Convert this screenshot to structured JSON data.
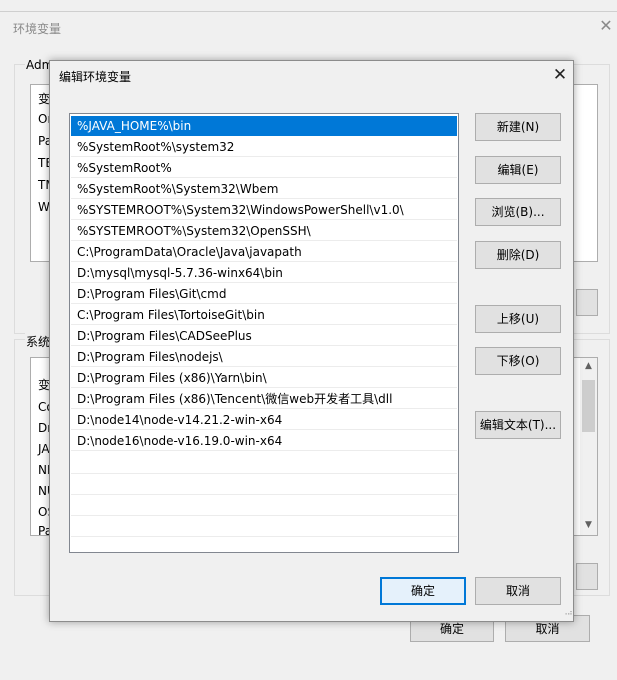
{
  "back_window": {
    "title": "环境变量",
    "user_group_label": "Adm",
    "user_rows": [
      "变",
      "On",
      "Pa",
      "TE",
      "TM",
      "W"
    ],
    "system_group_label": "系统",
    "system_rows": [
      "变",
      "Co",
      "Dr",
      "JA",
      "NL",
      "NU",
      "OS",
      "Pa"
    ],
    "ok_label": "确定",
    "cancel_label": "取消"
  },
  "dialog": {
    "title": "编辑环境变量",
    "paths": [
      "%JAVA_HOME%\\bin",
      "%SystemRoot%\\system32",
      "%SystemRoot%",
      "%SystemRoot%\\System32\\Wbem",
      "%SYSTEMROOT%\\System32\\WindowsPowerShell\\v1.0\\",
      "%SYSTEMROOT%\\System32\\OpenSSH\\",
      "C:\\ProgramData\\Oracle\\Java\\javapath",
      "D:\\mysql\\mysql-5.7.36-winx64\\bin",
      "D:\\Program Files\\Git\\cmd",
      "C:\\Program Files\\TortoiseGit\\bin",
      "D:\\Program Files\\CADSeePlus",
      "D:\\Program Files\\nodejs\\",
      "D:\\Program Files (x86)\\Yarn\\bin\\",
      "D:\\Program Files (x86)\\Tencent\\微信web开发者工具\\dll",
      "D:\\node14\\node-v14.21.2-win-x64",
      "D:\\node16\\node-v16.19.0-win-x64"
    ],
    "selected_index": 0,
    "buttons": {
      "new": "新建(N)",
      "edit": "编辑(E)",
      "browse": "浏览(B)...",
      "delete": "删除(D)",
      "move_up": "上移(U)",
      "move_down": "下移(O)",
      "edit_text": "编辑文本(T)..."
    },
    "ok_label": "确定",
    "cancel_label": "取消"
  },
  "colors": {
    "selection": "#0078d7",
    "default_button_border": "#0078d7"
  }
}
